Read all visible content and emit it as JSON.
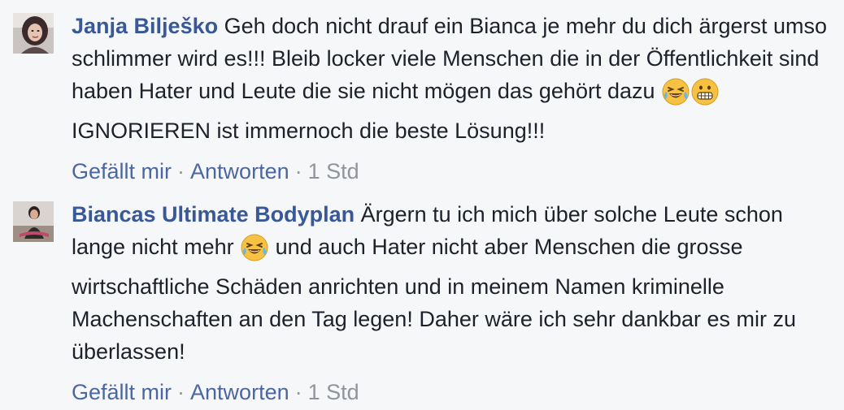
{
  "comments": [
    {
      "author": "Janja Bilješko",
      "text_part1": "Geh doch nicht drauf ein Bianca je mehr du dich ärgerst umso schlimmer wird es!!! Bleib locker viele Menschen die in der Öffentlichkeit sind haben Hater und Leute die sie nicht mögen das gehört dazu",
      "text_part2": "IGNORIEREN ist immernoch die beste Lösung!!!",
      "emojis": [
        "laughing-tears-emoji",
        "grimacing-emoji"
      ],
      "actions": {
        "like_label": "Gefällt mir",
        "reply_label": "Antworten",
        "separator": "·",
        "time": "1 Std"
      }
    },
    {
      "author": "Biancas Ultimate Bodyplan",
      "text_part1": "Ärgern tu ich mich über solche Leute schon lange nicht mehr",
      "text_part2": "und auch Hater nicht aber Menschen die grosse wirtschaftliche Schäden anrichten und in meinem Namen kriminelle Machenschaften an den Tag legen! Daher wäre ich sehr dankbar es mir zu überlassen!",
      "emojis": [
        "laughing-tears-emoji"
      ],
      "actions": {
        "like_label": "Gefällt mir",
        "reply_label": "Antworten",
        "separator": "·",
        "time": "1 Std"
      }
    }
  ],
  "colors": {
    "background": "#f6f7f9",
    "author": "#385898",
    "link": "#4b67a1",
    "meta": "#90949c",
    "text": "#1d2129"
  }
}
